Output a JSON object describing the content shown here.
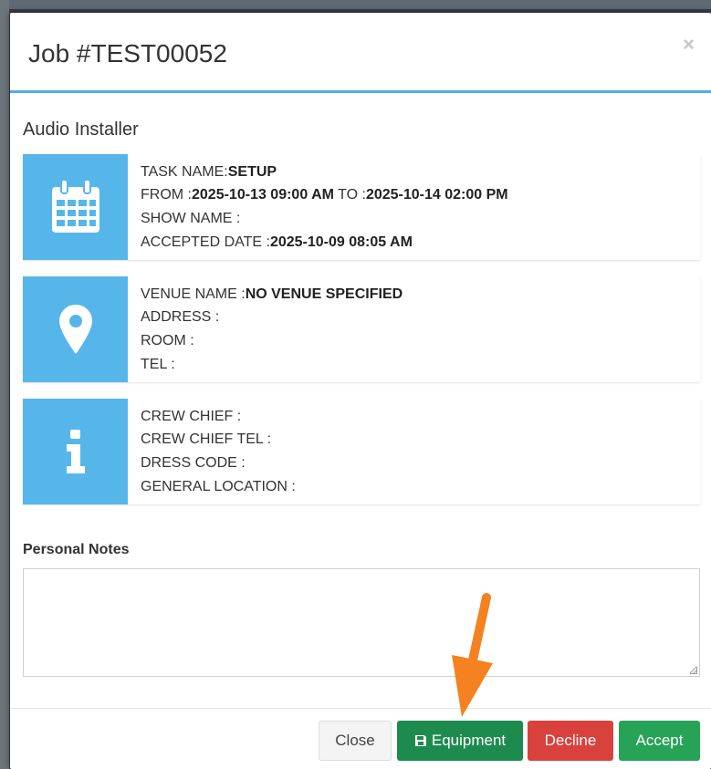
{
  "modal": {
    "title": "Job #TEST00052",
    "close_symbol": "×",
    "section_title": "Audio Installer"
  },
  "task_card": {
    "icon": "calendar-icon",
    "task_name_label": "TASK NAME:",
    "task_name_value": "SETUP",
    "from_label": "FROM :",
    "from_value": "2025-10-13 09:00 AM",
    "to_label": " TO :",
    "to_value": "2025-10-14 02:00 PM",
    "show_name_label": "SHOW NAME :",
    "show_name_value": "",
    "accepted_date_label": "ACCEPTED DATE :",
    "accepted_date_value": "2025-10-09 08:05 AM"
  },
  "venue_card": {
    "icon": "map-marker-icon",
    "venue_name_label": "VENUE NAME :",
    "venue_name_value": "NO VENUE SPECIFIED",
    "address_label": "ADDRESS :",
    "room_label": "ROOM :",
    "tel_label": "TEL :"
  },
  "crew_card": {
    "icon": "info-icon",
    "crew_chief_label": "CREW CHIEF :",
    "crew_chief_tel_label": "CREW CHIEF TEL :",
    "dress_code_label": "DRESS CODE :",
    "general_location_label": "GENERAL LOCATION :"
  },
  "notes": {
    "label": "Personal Notes",
    "value": ""
  },
  "footer": {
    "close_label": "Close",
    "equipment_label": "Equipment",
    "decline_label": "Decline",
    "accept_label": "Accept"
  },
  "colors": {
    "header_accent": "#4ab0e7",
    "icon_tile": "#56b6ea",
    "equipment_button": "#1e8b4e",
    "decline_button": "#d9413d",
    "accept_button": "#26a357",
    "annotation_arrow": "#f58220"
  }
}
